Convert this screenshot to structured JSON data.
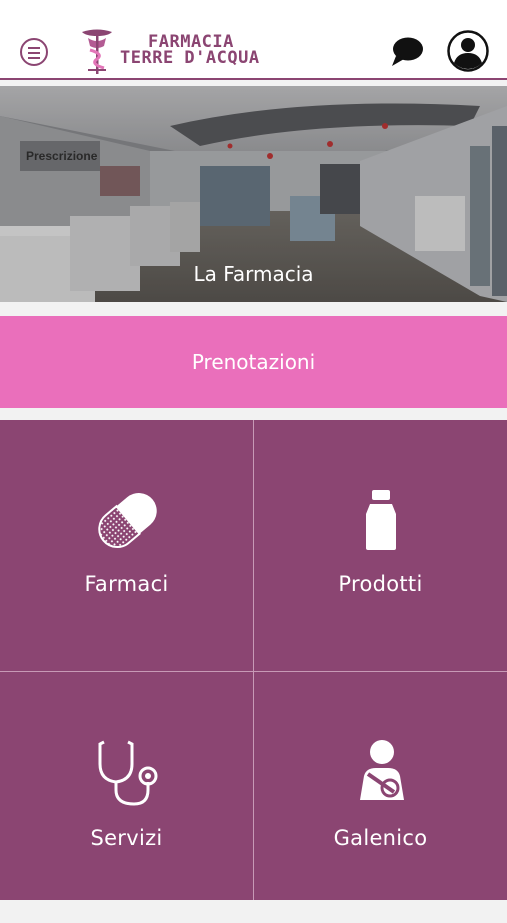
{
  "header": {
    "brand_line1": "FARMACIA",
    "brand_line2": "TERRE D'ACQUA",
    "icons": {
      "menu": "hamburger-circle-icon",
      "chat": "chat-bubble-icon",
      "profile": "user-profile-icon"
    }
  },
  "hero": {
    "title": "La Farmacia",
    "sign_text": "Prescrizione"
  },
  "booking": {
    "label": "Prenotazioni"
  },
  "tiles": [
    {
      "label": "Farmaci",
      "icon": "pill-capsule-icon"
    },
    {
      "label": "Prodotti",
      "icon": "bottle-icon"
    },
    {
      "label": "Servizi",
      "icon": "stethoscope-icon"
    },
    {
      "label": "Galenico",
      "icon": "injured-person-icon"
    }
  ],
  "colors": {
    "brand": "#8b4572",
    "accent_pink": "#ea6fbb",
    "tile_bg": "#8b4572",
    "header_bg": "#ffffff"
  }
}
